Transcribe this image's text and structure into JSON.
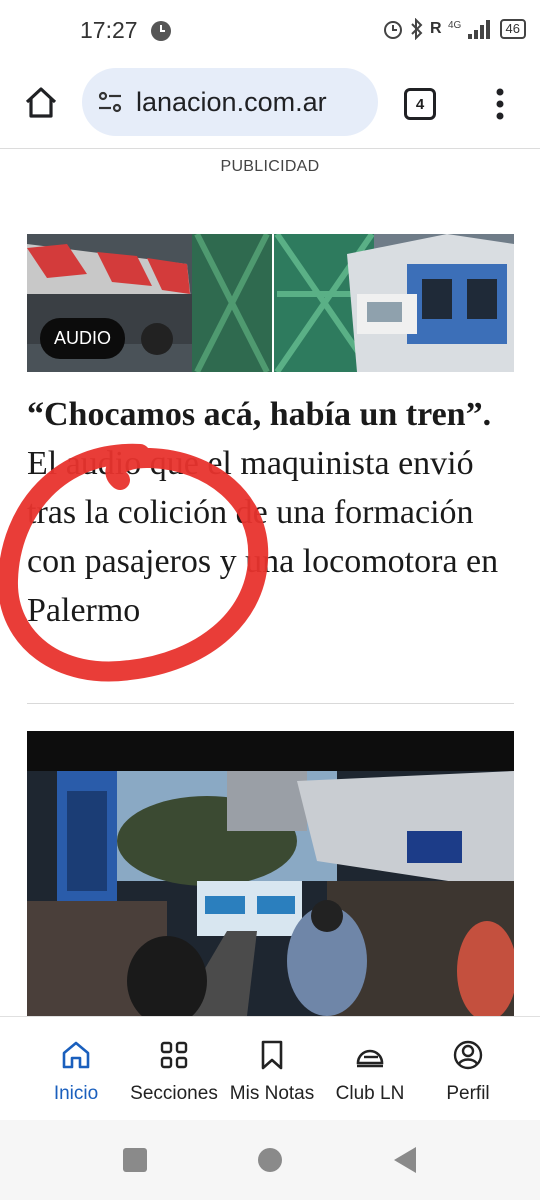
{
  "status": {
    "time": "17:27",
    "battery": "46"
  },
  "browser": {
    "url": "lanacion.com.ar",
    "tab_count": "4"
  },
  "ad_label": "PUBLICIDAD",
  "article": {
    "badge": "AUDIO",
    "headline_quote": "“Chocamos acá, había un tren”.",
    "headline_rest": " El audio que el maquinista envió tras la colición de una formación con pasajeros y una locomotora en Palermo"
  },
  "nav": {
    "items": [
      {
        "label": "Inicio",
        "icon": "home-icon"
      },
      {
        "label": "Secciones",
        "icon": "grid-icon"
      },
      {
        "label": "Mis Notas",
        "icon": "bookmark-icon"
      },
      {
        "label": "Club LN",
        "icon": "club-icon"
      },
      {
        "label": "Perfil",
        "icon": "profile-icon"
      }
    ]
  },
  "colors": {
    "accent": "#1a5fbd",
    "omnibox": "#e6edf9",
    "annotation": "#e8332d"
  }
}
